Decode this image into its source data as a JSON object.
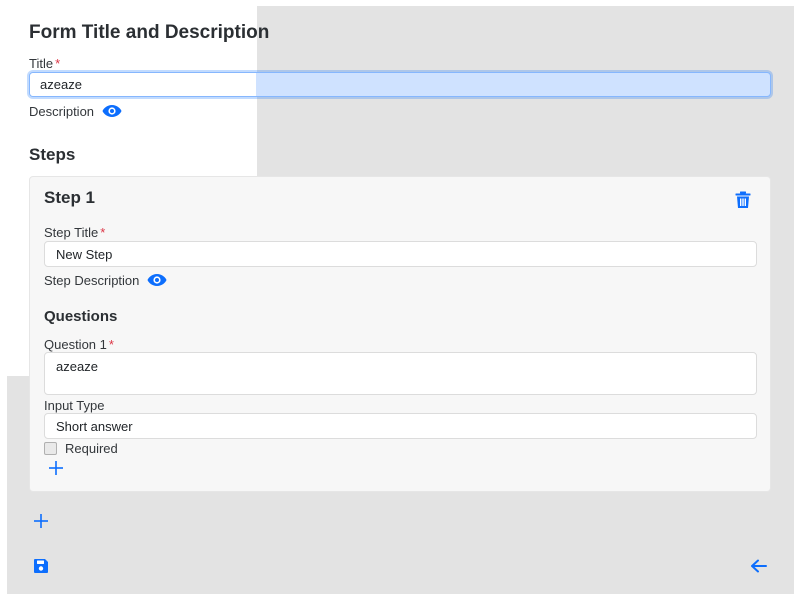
{
  "form": {
    "heading": "Form Title and Description",
    "title_label": "Title",
    "required_mark": "*",
    "title_value": "azeaze",
    "description_label": "Description"
  },
  "steps": {
    "heading": "Steps",
    "items": [
      {
        "title": "Step 1",
        "step_title_label": "Step Title",
        "step_title_value": "New Step",
        "step_description_label": "Step Description",
        "questions_heading": "Questions",
        "questions": [
          {
            "label": "Question 1",
            "value": "azeaze",
            "input_type_label": "Input Type",
            "input_type_value": "Short answer",
            "required_label": "Required",
            "required_checked": false
          }
        ]
      }
    ]
  },
  "icons": {
    "eye": "eye-icon",
    "trash": "trash-icon",
    "plus": "plus-icon",
    "save": "save-icon",
    "back": "arrow-left-icon"
  },
  "colors": {
    "accent": "#0d6efd",
    "required": "#dc3545",
    "background": "#e3e3e3",
    "card": "#f7f7f7"
  }
}
